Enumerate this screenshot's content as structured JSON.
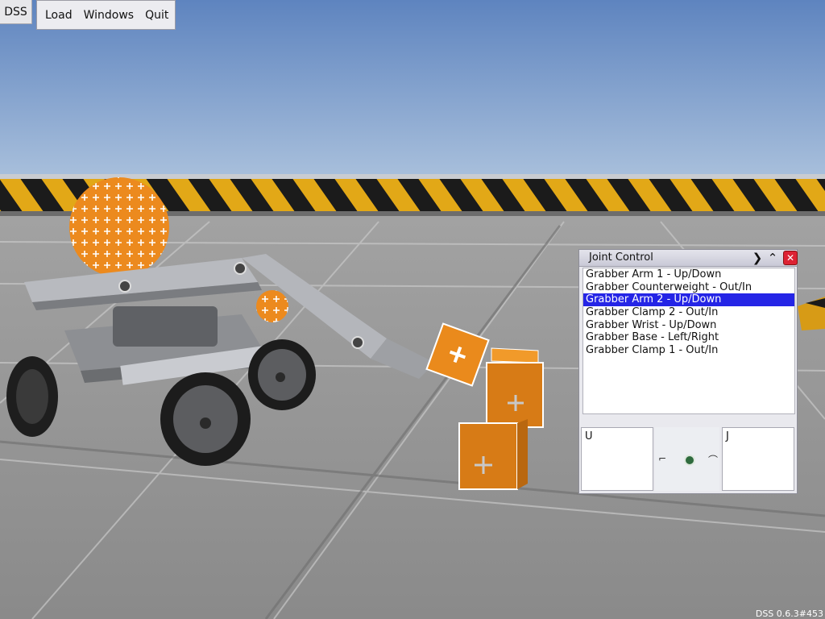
{
  "app": {
    "button_label": "DSS",
    "version": "DSS 0.6.3#453"
  },
  "menu": {
    "items": [
      "Load",
      "Windows",
      "Quit"
    ]
  },
  "joint_window": {
    "title": "Joint Control",
    "next_icon": "chevron-right-icon",
    "collapse_icon": "chevron-up-icon",
    "close_icon": "close-icon",
    "joints": [
      "Grabber Arm 1 - Up/Down",
      "Grabber Counterweight - Out/In",
      "Grabber Arm 2 - Up/Down",
      "Grabber Clamp 2 - Out/In",
      "Grabber Wrist - Up/Down",
      "Grabber Base - Left/Right",
      "Grabber Clamp 1 - Out/In"
    ],
    "selected_index": 2,
    "left_label": "U",
    "right_label": "J"
  },
  "colors": {
    "selection": "#2525e6",
    "sky": "#6f93c8",
    "floor": "#9a9a9a",
    "cube": "#e8881d"
  }
}
